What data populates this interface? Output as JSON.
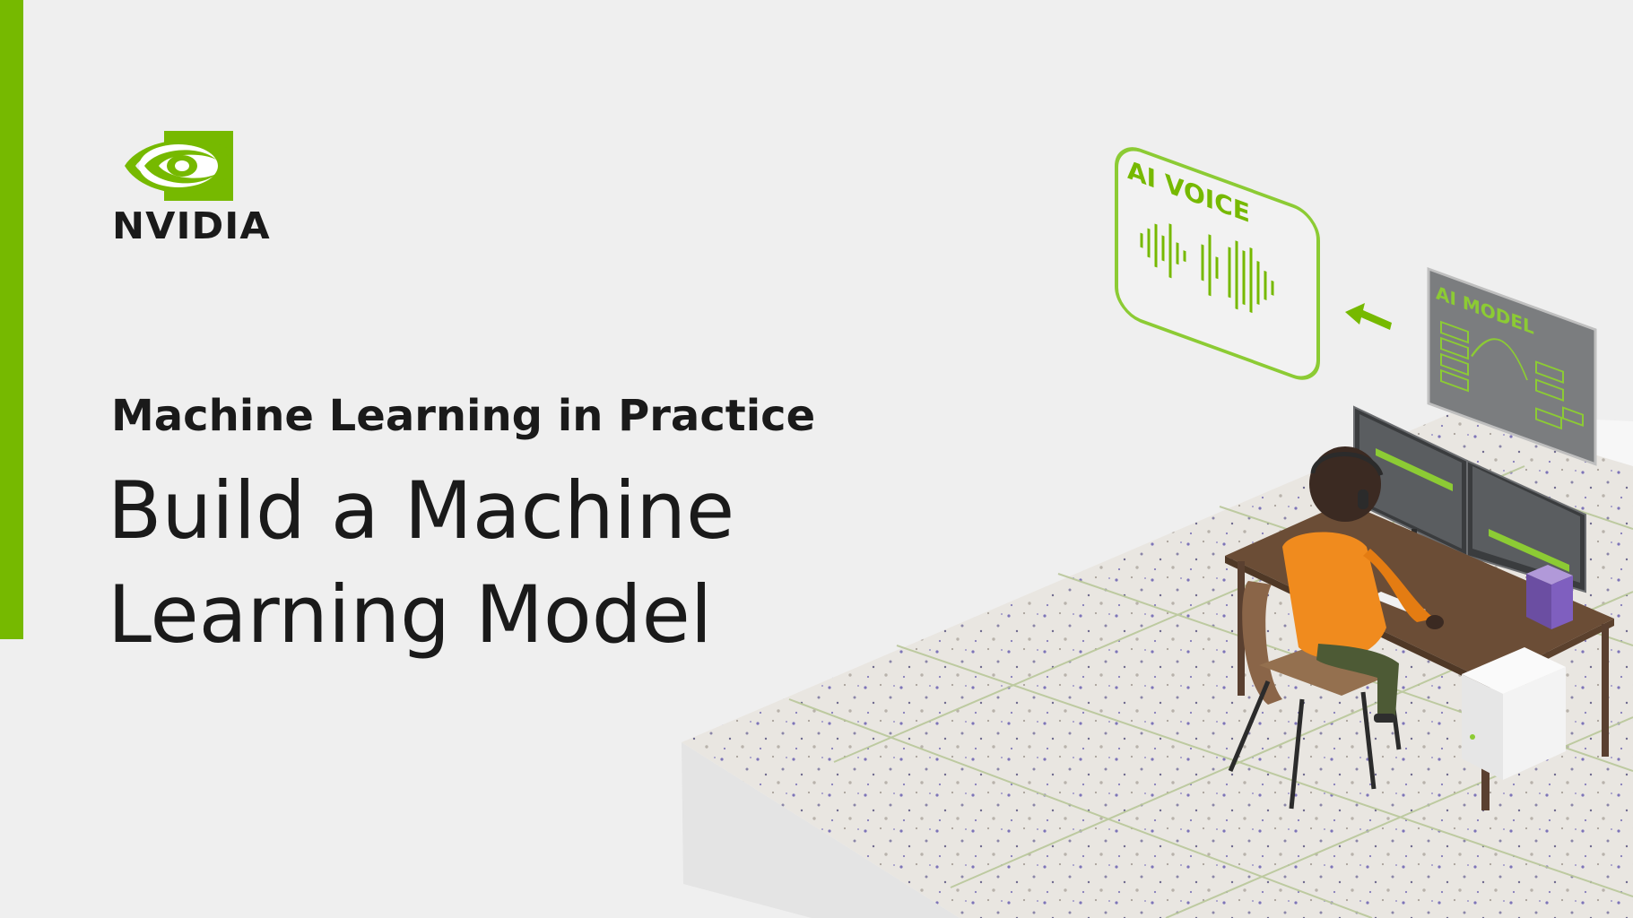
{
  "brand": {
    "name": "NVIDIA",
    "color": "#76b900"
  },
  "header": {
    "subtitle": "Machine Learning in Practice",
    "title_line1": "Build a Machine",
    "title_line2": "Learning Model"
  },
  "illustration": {
    "voice_panel_label": "AI VOICE",
    "model_panel_label": "AI MODEL"
  }
}
